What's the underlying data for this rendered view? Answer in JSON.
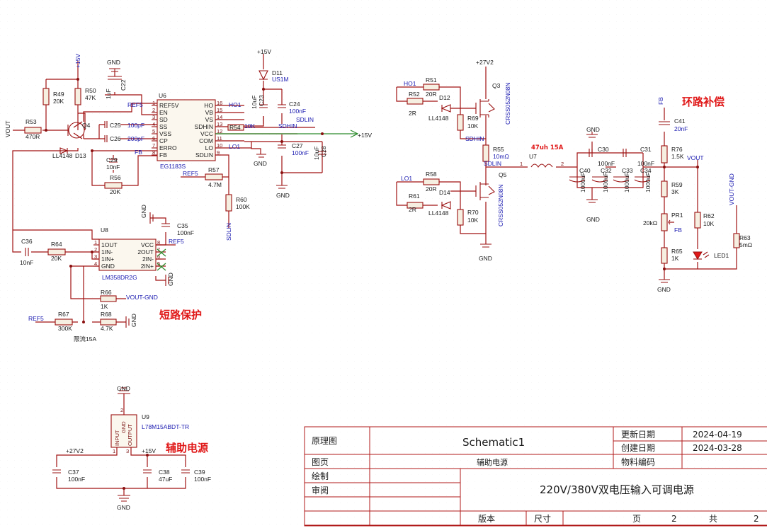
{
  "notes": {
    "short_circuit": "短路保护",
    "loop_comp": "环路补偿",
    "aux_power": "辅助电源"
  },
  "ics": {
    "u6": {
      "ref": "U6",
      "part": "EG1183S",
      "pins_left": [
        "REF5V",
        "EN",
        "SD",
        "SS",
        "VSS",
        "CP",
        "ERRO",
        "FB"
      ],
      "pins_right": [
        "HO",
        "VB",
        "VS",
        "SDHIN",
        "VCC",
        "COM",
        "LO",
        "SDLIN"
      ],
      "nums_left": [
        "1",
        "2",
        "3",
        "4",
        "5",
        "6",
        "7",
        "8"
      ],
      "nums_right": [
        "16",
        "15",
        "14",
        "13",
        "12",
        "11",
        "10",
        "9"
      ]
    },
    "u8": {
      "ref": "U8",
      "part": "LM358DR2G",
      "pins_left": [
        "1OUT",
        "1IN-",
        "1IN+",
        "GND"
      ],
      "pins_right": [
        "VCC",
        "2OUT",
        "2IN-",
        "2IN+"
      ],
      "nums_left": [
        "1",
        "2",
        "3",
        "4"
      ],
      "nums_right": [
        "8",
        "7",
        "6",
        "5"
      ]
    },
    "u9": {
      "ref": "U9",
      "part": "L78M15ABDT-TR",
      "pin1": "INPUT",
      "pin2": "GND",
      "pin3": "OUTPUT",
      "n1": "1",
      "n2": "2",
      "n3": "3"
    },
    "q3": {
      "ref": "Q3",
      "part": "CRSS052N08N"
    },
    "q5": {
      "ref": "Q5",
      "part": "CRSS052N08N"
    },
    "q4": {
      "ref": "Q4"
    },
    "u7": {
      "ref": "U7",
      "value": "47uh 15A",
      "p1": "1",
      "p2": "2"
    }
  },
  "parts": {
    "r49": {
      "ref": "R49",
      "val": "20K"
    },
    "r50": {
      "ref": "R50",
      "val": "47K"
    },
    "r53": {
      "ref": "R53",
      "val": "470R"
    },
    "r56": {
      "ref": "R56",
      "val": "20K"
    },
    "r57": {
      "ref": "R57",
      "val": "4.7M"
    },
    "r60": {
      "ref": "R60",
      "val": "100K"
    },
    "r54": {
      "ref": "R54"
    },
    "r64": {
      "ref": "R64",
      "val": "20K"
    },
    "r66": {
      "ref": "R66",
      "val": "1K"
    },
    "r67": {
      "ref": "R67",
      "val": "300K"
    },
    "r68": {
      "ref": "R68",
      "val": "4.7K"
    },
    "r51": {
      "ref": "R51",
      "val": "20R"
    },
    "r52": {
      "ref": "R52",
      "val": "2R"
    },
    "r69": {
      "ref": "R69",
      "val": "10K"
    },
    "r55": {
      "ref": "R55",
      "val": "10mΩ"
    },
    "r58": {
      "ref": "R58",
      "val": "20R"
    },
    "r61": {
      "ref": "R61",
      "val": "2R"
    },
    "r70": {
      "ref": "R70",
      "val": "10K"
    },
    "r76": {
      "ref": "R76",
      "val": "1.5K"
    },
    "r59": {
      "ref": "R59",
      "val": "3K"
    },
    "r65": {
      "ref": "R65",
      "val": "1K"
    },
    "r62": {
      "ref": "R62",
      "val": "10K"
    },
    "r63": {
      "ref": "R63",
      "val": "5mΩ"
    },
    "pr1": {
      "ref": "PR1",
      "val": "20kΩ"
    },
    "c22": {
      "ref": "C22",
      "val": "1uF"
    },
    "c23": {
      "ref": "C23",
      "val": "10uF"
    },
    "c24": {
      "ref": "C24",
      "val": "100nF"
    },
    "c25": {
      "ref": "C25",
      "val": "100pF"
    },
    "c26": {
      "ref": "C26",
      "val": "200pF"
    },
    "c27": {
      "ref": "C27",
      "val": "100nF"
    },
    "c28": {
      "ref": "C28",
      "val": "10uF"
    },
    "c29": {
      "ref": "C29",
      "val": "10nF"
    },
    "c35": {
      "ref": "C35",
      "val": "100nF"
    },
    "c36": {
      "ref": "C36",
      "val": "10nF"
    },
    "c37": {
      "ref": "C37",
      "val": "100nF"
    },
    "c38": {
      "ref": "C38",
      "val": "47uF"
    },
    "c39": {
      "ref": "C39",
      "val": "100nF"
    },
    "c30": {
      "ref": "C30",
      "val": "100nF"
    },
    "c31": {
      "ref": "C31",
      "val": "100nF"
    },
    "c32": {
      "ref": "C32",
      "val": "1000uF"
    },
    "c33": {
      "ref": "C33",
      "val": "1000uF"
    },
    "c34": {
      "ref": "C34",
      "val": "1000uF"
    },
    "c40": {
      "ref": "C40",
      "val": "1000uF"
    },
    "c41": {
      "ref": "C41",
      "val": "20nF"
    },
    "d11": {
      "ref": "D11",
      "val": "US1M"
    },
    "d12": {
      "ref": "D12",
      "val": "LL4148"
    },
    "d13": {
      "ref": "D13",
      "val": "LL4148"
    },
    "d14": {
      "ref": "D14",
      "val": "LL4148"
    },
    "led1": {
      "ref": "LED1"
    },
    "limit": "限流15A"
  },
  "nets": {
    "p15v": "+15V",
    "p27v2": "+27V2",
    "gnd": "GND",
    "vout": "VOUT",
    "ref5": "REF5",
    "fb": "FB",
    "ho1": "HO1",
    "lo1": "LO1",
    "sdlin": "SDLIN",
    "sdhin": "SDHIN",
    "vout_gnd": "VOUT-GND",
    "k10": "10K"
  },
  "titleblock": {
    "schematic_label": "原理图",
    "schematic_name": "Schematic1",
    "page_label": "图页",
    "page_name": "辅助电源",
    "drawn": "绘制",
    "review": "审阅",
    "update_label": "更新日期",
    "update_date": "2024-04-19",
    "create_label": "创建日期",
    "create_date": "2024-03-28",
    "material_label": "物料编码",
    "title": "220V/380V双电压输入可调电源",
    "version_label": "版本",
    "size_label": "尺寸",
    "page_word": "页",
    "page_num": "2",
    "total_word": "共",
    "total_num": "2"
  }
}
